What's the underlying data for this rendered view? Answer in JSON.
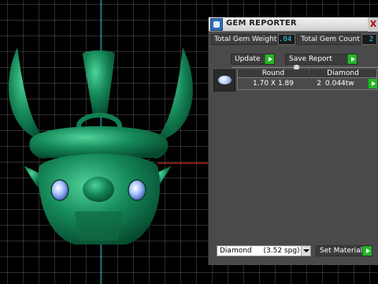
{
  "panel": {
    "title": "GEM REPORTER",
    "close_glyph": "X",
    "total_weight_label": "Total Gem Weight",
    "total_weight_value": ".04",
    "total_count_label": "Total Gem Count",
    "total_count_value": "2",
    "update_label": "Update",
    "save_report_label": "Save Report",
    "table": {
      "headers": [
        "Round",
        "Diamond"
      ],
      "row": {
        "size": "1.70 X 1.89",
        "count": "2",
        "weight": "0.044tw"
      }
    },
    "material_select": {
      "name": "Diamond",
      "spg": "(3.52 spg)"
    },
    "set_material_label": "Set Material"
  },
  "icons": [
    "app-icon",
    "close-icon",
    "go-arrow-icon",
    "gem-thumbnail-icon",
    "dropdown-arrow-icon"
  ],
  "colors": {
    "model_green": "#1f8a5a",
    "gem_blue": "#a9c3ff",
    "value_cyan": "#39d0ff",
    "go_green": "#25b825",
    "axis_red": "#ff2a2a",
    "axis_cyan": "#1dbfe0"
  }
}
